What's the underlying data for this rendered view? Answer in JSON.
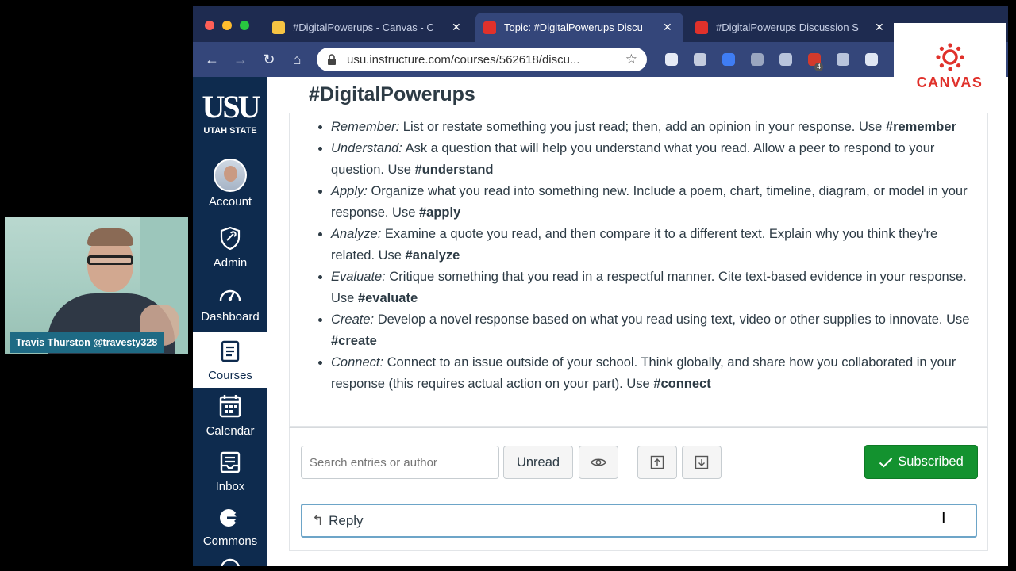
{
  "webcam": {
    "name": "Travis Thurston @travesty328"
  },
  "browser": {
    "traffic_colors": [
      "#ff5f57",
      "#febc2e",
      "#28c840"
    ],
    "tabs": [
      {
        "title": "#DigitalPowerups - Canvas - C",
        "close": "✕",
        "favicon_color": "#f6c443",
        "active": false
      },
      {
        "title": "Topic: #DigitalPowerups Discu",
        "close": "✕",
        "favicon_color": "#e0312b",
        "active": true
      },
      {
        "title": "#DigitalPowerups Discussion S",
        "close": "✕",
        "favicon_color": "#e0312b",
        "active": false
      }
    ],
    "url": "usu.instructure.com/courses/562618/discu...",
    "extension_colors": [
      "#e5eaf5",
      "#c4ccde",
      "#3f7df3",
      "#9aa6c0",
      "#b8c4dc",
      "#d33a2c",
      "#b8c4dc",
      "#dfe6f3",
      "#5b8fe8"
    ],
    "extension_badge": "4"
  },
  "overlay_logo": {
    "wordmark": "CANVAS",
    "color": "#e0312b"
  },
  "globalnav": {
    "logo_big": "USU",
    "logo_small": "UTAH STATE",
    "items": [
      {
        "label": "Account",
        "icon": "avatar"
      },
      {
        "label": "Admin",
        "icon": "shield-icon"
      },
      {
        "label": "Dashboard",
        "icon": "dashboard-icon"
      },
      {
        "label": "Courses",
        "icon": "courses-icon",
        "active": true
      },
      {
        "label": "Calendar",
        "icon": "calendar-icon"
      },
      {
        "label": "Inbox",
        "icon": "inbox-icon"
      },
      {
        "label": "Commons",
        "icon": "commons-icon"
      }
    ]
  },
  "page": {
    "title": "#DigitalPowerups",
    "prompts": [
      {
        "verb": "Remember:",
        "text": " List or restate something you just read; then, add an opinion in your response. Use ",
        "tag": "#remember"
      },
      {
        "verb": "Understand:",
        "text": " Ask a question that will help you understand what you read. Allow a peer to respond to your question. Use ",
        "tag": "#understand"
      },
      {
        "verb": "Apply:",
        "text": " Organize what you read into something new. Include a poem, chart, timeline, diagram, or model in your response. Use ",
        "tag": "#apply"
      },
      {
        "verb": "Analyze:",
        "text": " Examine a quote you read, and then compare it to a different text. Explain why you think they're related. Use ",
        "tag": "#analyze"
      },
      {
        "verb": "Evaluate:",
        "text": " Critique something that you read in a respectful manner. Cite text-based evidence in your response. Use ",
        "tag": "#evaluate"
      },
      {
        "verb": "Create:",
        "text": " Develop a novel response based on what you read using text, video or other supplies to innovate. Use ",
        "tag": "#create"
      },
      {
        "verb": "Connect:",
        "text": " Connect to an issue outside of your school. Think globally, and share how you collaborated in your response (this requires actual action on your part). Use ",
        "tag": "#connect"
      }
    ]
  },
  "discussion_toolbar": {
    "search_placeholder": "Search entries or author",
    "unread_label": "Unread",
    "subscribed_label": "Subscribed",
    "subscribed_color": "#13922f"
  },
  "reply": {
    "label": "Reply"
  }
}
